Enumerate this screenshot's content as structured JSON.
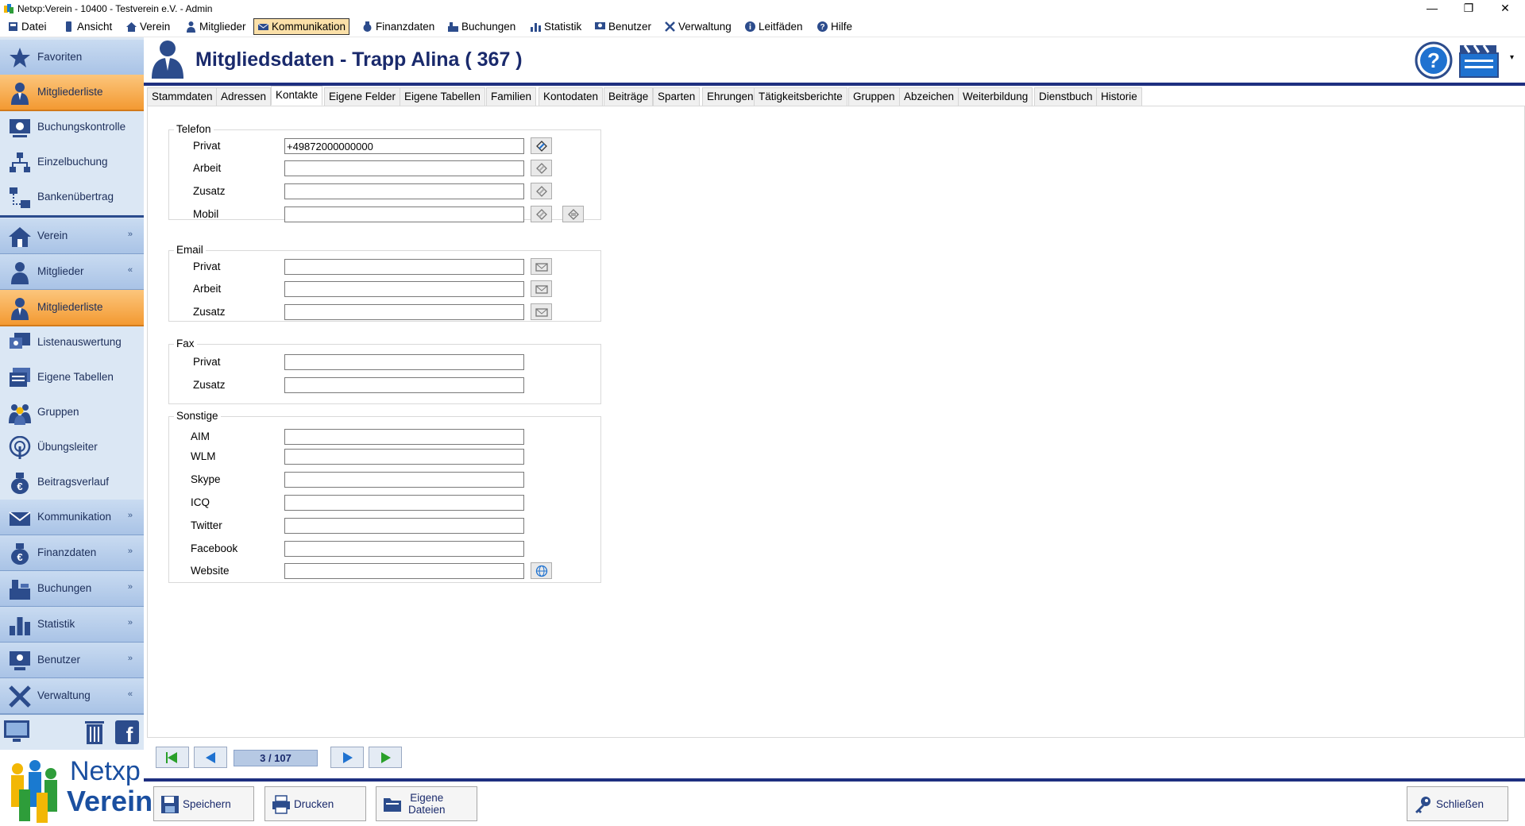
{
  "window": {
    "title": "Netxp:Verein - 10400 - Testverein e.V. - Admin",
    "minimize": "—",
    "maximize": "❐",
    "close": "✕"
  },
  "menu": [
    {
      "label": "Datei",
      "icon": "file-icon"
    },
    {
      "label": "Ansicht",
      "icon": "phone-icon"
    },
    {
      "label": "Verein",
      "icon": "house-icon"
    },
    {
      "label": "Mitglieder",
      "icon": "member-icon"
    },
    {
      "label": "Kommunikation",
      "icon": "communication-icon",
      "active": true
    },
    {
      "label": "Finanzdaten",
      "icon": "money-bag-icon"
    },
    {
      "label": "Buchungen",
      "icon": "register-icon"
    },
    {
      "label": "Statistik",
      "icon": "chart-icon"
    },
    {
      "label": "Benutzer",
      "icon": "user-icon"
    },
    {
      "label": "Verwaltung",
      "icon": "tools-icon"
    },
    {
      "label": "Leitfäden",
      "icon": "info-icon"
    },
    {
      "label": "Hilfe",
      "icon": "help-icon"
    }
  ],
  "sidebar": {
    "items": [
      {
        "label": "Favoriten",
        "style": "header",
        "icon": "star-icon"
      },
      {
        "label": "Mitgliederliste",
        "style": "orange",
        "icon": "member-icon"
      },
      {
        "label": "Buchungskontrolle",
        "style": "plain",
        "icon": "control-icon"
      },
      {
        "label": "Einzelbuchung",
        "style": "plain",
        "icon": "tree-icon"
      },
      {
        "label": "Bankenübertrag",
        "style": "plain",
        "icon": "transfer-icon"
      },
      {
        "label": "Verein",
        "style": "header",
        "icon": "house-icon",
        "chevron": "»"
      },
      {
        "label": "Mitglieder",
        "style": "header",
        "icon": "member-icon",
        "chevron": "«"
      },
      {
        "label": "Mitgliederliste",
        "style": "orange",
        "icon": "member-icon"
      },
      {
        "label": "Listenauswertung",
        "style": "plain",
        "icon": "list-icon"
      },
      {
        "label": "Eigene Tabellen",
        "style": "plain",
        "icon": "table-icon"
      },
      {
        "label": "Gruppen",
        "style": "plain",
        "icon": "group-icon"
      },
      {
        "label": "Übungsleiter",
        "style": "plain",
        "icon": "trainer-icon"
      },
      {
        "label": "Beitragsverlauf",
        "style": "plain",
        "icon": "euro-bag-icon"
      },
      {
        "label": "Kommunikation",
        "style": "header",
        "icon": "communication-icon",
        "chevron": "»"
      },
      {
        "label": "Finanzdaten",
        "style": "header",
        "icon": "euro-bag-icon",
        "chevron": "»"
      },
      {
        "label": "Buchungen",
        "style": "header",
        "icon": "register-icon",
        "chevron": "»"
      },
      {
        "label": "Statistik",
        "style": "header",
        "icon": "chart-icon",
        "chevron": "»"
      },
      {
        "label": "Benutzer",
        "style": "header",
        "icon": "user-icon",
        "chevron": "»"
      },
      {
        "label": "Verwaltung",
        "style": "header",
        "icon": "tools-icon",
        "chevron": "«"
      }
    ]
  },
  "logo": {
    "line1": "Netxp",
    "line2": "Verein"
  },
  "header": {
    "title": "Mitgliedsdaten - Trapp Alina ( 367 )"
  },
  "tabs": [
    "Stammdaten",
    "Adressen",
    "Kontakte",
    "Eigene Felder",
    "Eigene Tabellen",
    "Familien",
    "Kontodaten",
    "Beiträge",
    "Sparten",
    "Ehrungen",
    "Tätigkeitsberichte",
    "Gruppen",
    "Abzeichen",
    "Weiterbildung",
    "Dienstbuch",
    "Historie"
  ],
  "active_tab": "Kontakte",
  "form": {
    "telefon": {
      "title": "Telefon",
      "rows": [
        {
          "label": "Privat",
          "value": "+49872000000000"
        },
        {
          "label": "Arbeit",
          "value": ""
        },
        {
          "label": "Zusatz",
          "value": ""
        },
        {
          "label": "Mobil",
          "value": ""
        }
      ]
    },
    "email": {
      "title": "Email",
      "rows": [
        {
          "label": "Privat",
          "value": ""
        },
        {
          "label": "Arbeit",
          "value": ""
        },
        {
          "label": "Zusatz",
          "value": ""
        }
      ]
    },
    "fax": {
      "title": "Fax",
      "rows": [
        {
          "label": "Privat",
          "value": ""
        },
        {
          "label": "Zusatz",
          "value": ""
        }
      ]
    },
    "sonstige": {
      "title": "Sonstige",
      "rows": [
        {
          "label": "AIM",
          "value": ""
        },
        {
          "label": "WLM",
          "value": ""
        },
        {
          "label": "Skype",
          "value": ""
        },
        {
          "label": "ICQ",
          "value": ""
        },
        {
          "label": "Twitter",
          "value": ""
        },
        {
          "label": "Facebook",
          "value": ""
        },
        {
          "label": "Website",
          "value": ""
        }
      ]
    }
  },
  "pager": {
    "text": "3 / 107"
  },
  "buttons": {
    "save": "Speichern",
    "print": "Drucken",
    "files": "Eigene\nDateien",
    "close": "Schließen"
  },
  "colors": {
    "accent_navy": "#1e2f80",
    "sidebar_bg": "#dbe7f4",
    "orange": "#f39a32",
    "pager_green": "#2aa02a",
    "pager_blue": "#1f72d0"
  }
}
